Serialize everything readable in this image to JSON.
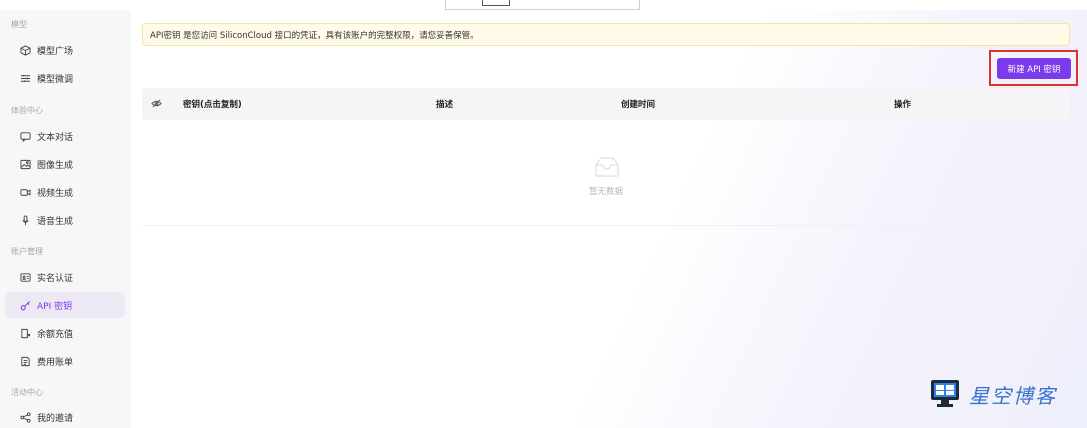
{
  "sidebar": {
    "groups": [
      {
        "label": "模型"
      },
      {
        "label": "体验中心"
      },
      {
        "label": "账户管理"
      },
      {
        "label": "活动中心"
      }
    ],
    "items": [
      {
        "label": "模型广场"
      },
      {
        "label": "模型微调"
      },
      {
        "label": "文本对话"
      },
      {
        "label": "图像生成"
      },
      {
        "label": "视频生成"
      },
      {
        "label": "语音生成"
      },
      {
        "label": "实名认证"
      },
      {
        "label": "API 密钥"
      },
      {
        "label": "余额充值"
      },
      {
        "label": "费用账单"
      },
      {
        "label": "我的邀请"
      }
    ],
    "active_item": "API 密钥"
  },
  "main": {
    "notice": "API密钥 是您访问 SiliconCloud 接口的凭证，具有该账户的完整权限，请您妥善保管。",
    "create_button": "新建 API 密钥",
    "table": {
      "columns": [
        "密钥(点击复制)",
        "描述",
        "创建时间",
        "操作"
      ],
      "rows": [],
      "empty_text": "暂无数据"
    }
  },
  "watermark": {
    "text": "星空博客"
  },
  "colors": {
    "accent": "#7c3aed",
    "highlight_box": "#e03131",
    "notice_bg": "#fffbe8"
  }
}
